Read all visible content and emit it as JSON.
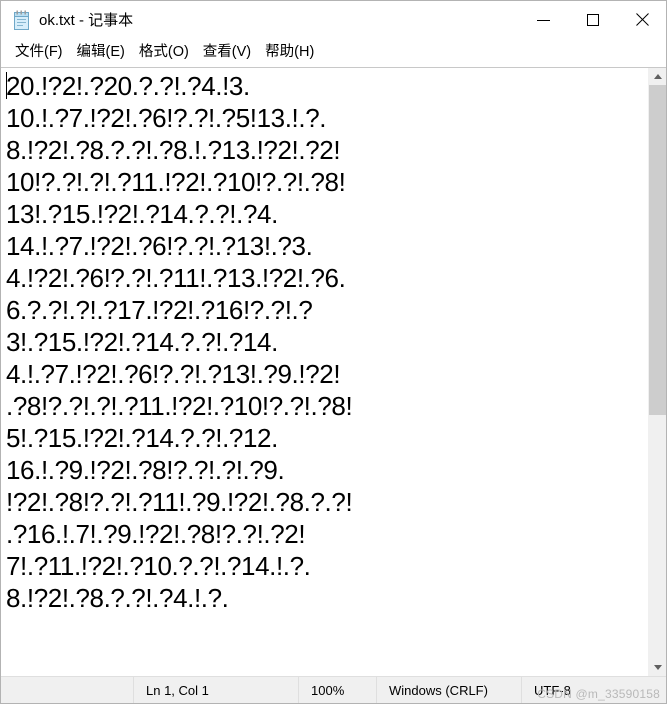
{
  "window": {
    "title": "ok.txt - 记事本",
    "icon": "notepad-icon"
  },
  "caption": {
    "minimize_label": "最小化",
    "maximize_label": "最大化",
    "close_label": "关闭"
  },
  "menubar": {
    "items": [
      {
        "label": "文件(F)",
        "name": "menu-file"
      },
      {
        "label": "编辑(E)",
        "name": "menu-edit"
      },
      {
        "label": "格式(O)",
        "name": "menu-format"
      },
      {
        "label": "查看(V)",
        "name": "menu-view"
      },
      {
        "label": "帮助(H)",
        "name": "menu-help"
      }
    ]
  },
  "editor": {
    "lines": [
      "20.!?2!.?20.?.?!.?4.!3.",
      "10.!.?7.!?2!.?6!?.?!.?5!13.!.?.",
      "8.!?2!.?8.?.?!.?8.!.?13.!?2!.?2!",
      "10!?.?!.?!.?11.!?2!.?10!?.?!.?8!",
      "13!.?15.!?2!.?14.?.?!.?4.",
      "14.!.?7.!?2!.?6!?.?!.?13!.?3.",
      "4.!?2!.?6!?.?!.?11!.?13.!?2!.?6.",
      "6.?.?!.?!.?17.!?2!.?16!?.?!.?",
      "3!.?15.!?2!.?14.?.?!.?14.",
      "4.!.?7.!?2!.?6!?.?!.?13!.?9.!?2!",
      ".?8!?.?!.?!.?11.!?2!.?10!?.?!.?8!",
      "5!.?15.!?2!.?14.?.?!.?12.",
      "16.!.?9.!?2!.?8!?.?!.?!.?9.",
      "!?2!.?8!?.?!.?11!.?9.!?2!.?8.?.?!",
      ".?16.!.7!.?9.!?2!.?8!?.?!.?2!",
      "7!.?11.!?2!.?10.?.?!.?14.!.?.",
      "8.!?2!.?8.?.?!.?4.!.?."
    ]
  },
  "scrollbar": {
    "up_arrow": "scroll-up-arrow",
    "down_arrow": "scroll-down-arrow"
  },
  "statusbar": {
    "position": "Ln 1,  Col 1",
    "zoom": "100%",
    "line_ending": "Windows (CRLF)",
    "encoding": "UTF-8",
    "watermark": "CSDN @m_33590158"
  },
  "colors": {
    "window_bg": "#ffffff",
    "statusbar_bg": "#f0f0f0",
    "scrollbar_thumb": "#cdcdcd",
    "text": "#000000",
    "close_hover": "#e81123"
  }
}
